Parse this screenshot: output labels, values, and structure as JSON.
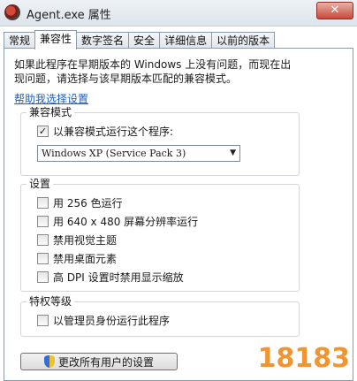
{
  "window": {
    "title": "Agent.exe 属性",
    "close_label": "✕"
  },
  "tabs": [
    {
      "label": "常规"
    },
    {
      "label": "兼容性",
      "active": true
    },
    {
      "label": "数字签名"
    },
    {
      "label": "安全"
    },
    {
      "label": "详细信息"
    },
    {
      "label": "以前的版本"
    }
  ],
  "page": {
    "intro_line1": "如果此程序在早期版本的 Windows 上没有问题，而现在出",
    "intro_line2": "现问题，请选择与该早期版本匹配的兼容模式。",
    "help_link": "帮助我选择设置"
  },
  "compat_mode": {
    "title": "兼容模式",
    "checkbox_label": "以兼容模式运行这个程序:",
    "checked": true,
    "selected_os": "Windows XP (Service Pack 3)"
  },
  "settings": {
    "title": "设置",
    "items": [
      {
        "label": "用 256 色运行",
        "checked": false
      },
      {
        "label": "用 640 x 480 屏幕分辨率运行",
        "checked": false
      },
      {
        "label": "禁用视觉主题",
        "checked": false
      },
      {
        "label": "禁用桌面元素",
        "checked": false
      },
      {
        "label": "高 DPI 设置时禁用显示缩放",
        "checked": false
      }
    ]
  },
  "privilege": {
    "title": "特权等级",
    "checkbox_label": "以管理员身份运行此程序",
    "checked": false
  },
  "change_all_button": "更改所有用户的设置",
  "watermark": "18183",
  "colors": {
    "link": "#1f5fbf",
    "accent_close": "#c9483a"
  }
}
